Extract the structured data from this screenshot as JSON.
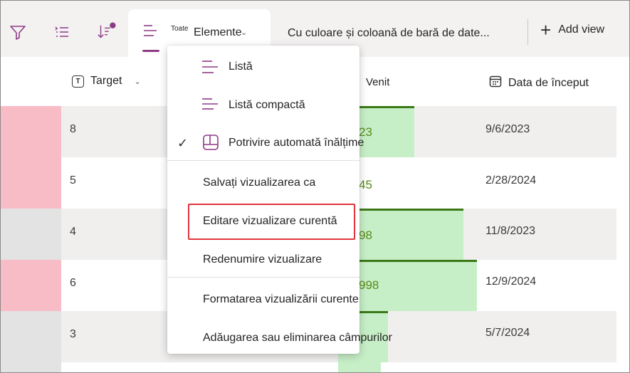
{
  "toolbar": {
    "filter_icon": "filter-icon",
    "group_icon": "group-list-icon",
    "sort_icon": "sort-icon",
    "active_view": {
      "prefix": "Toate",
      "label": "Elemente",
      "icon": "list-lines-icon"
    },
    "view_title": "Cu culoare și coloană de bară de date...",
    "add_view_label": "Add view",
    "accent_color": "#8e3b87"
  },
  "columns": {
    "target": "Target",
    "venit": "Venit",
    "start_date": "Data de început"
  },
  "rows": [
    {
      "color": "#f7bcc6",
      "target": "8",
      "venit": "23",
      "venit_fraction": 0.55,
      "date": "9/6/2023"
    },
    {
      "color": "#f7bcc6",
      "target": "5",
      "venit": "45",
      "venit_fraction": 0.0,
      "date": "2/28/2024"
    },
    {
      "color": "#e3e3e3",
      "target": "4",
      "venit": "98",
      "venit_fraction": 0.9,
      "date": "11/8/2023"
    },
    {
      "color": "#f7bcc6",
      "target": "6",
      "venit": "998",
      "venit_fraction": 1.0,
      "date": "12/9/2024"
    },
    {
      "color": "#e3e3e3",
      "target": "3",
      "venit": "",
      "venit_fraction": 0.36,
      "date": "5/7/2024"
    }
  ],
  "menu": {
    "items": [
      {
        "label": "Listă",
        "icon": "list-icon",
        "checked": false
      },
      {
        "label": "Listă compactă",
        "icon": "compact-list-icon",
        "checked": false
      },
      {
        "label": "Potrivire automată înălțime",
        "icon": "autofit-height-icon",
        "checked": true
      },
      {
        "label": "Salvați vizualizarea ca",
        "icon": "",
        "checked": false
      },
      {
        "label": "Editare vizualizare curentă",
        "icon": "",
        "checked": false,
        "highlighted": true
      },
      {
        "label": "Redenumire vizualizare",
        "icon": "",
        "checked": false
      },
      {
        "label": "Formatarea vizualizării curente",
        "icon": "",
        "checked": false
      },
      {
        "label": "Adăugarea sau eliminarea câmpurilor",
        "icon": "",
        "checked": false
      }
    ],
    "highlight_color": "#e0353d"
  }
}
